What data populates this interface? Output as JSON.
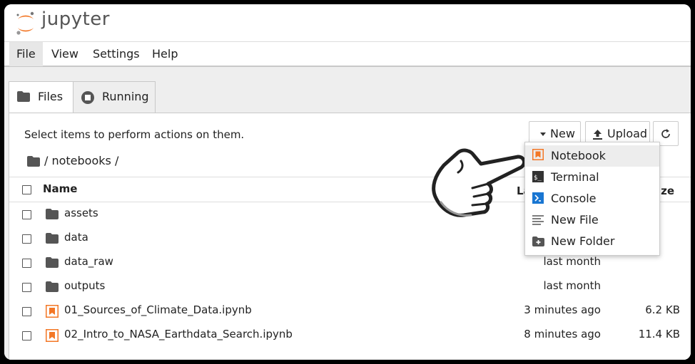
{
  "app": {
    "brand": "jupyter"
  },
  "menu": [
    "File",
    "View",
    "Settings",
    "Help"
  ],
  "tabs": {
    "files": "Files",
    "running": "Running"
  },
  "toolbar": {
    "hint": "Select items to perform actions on them.",
    "new_label": "New",
    "upload_label": "Upload"
  },
  "breadcrumb": {
    "path": "/ notebooks /"
  },
  "columns": {
    "name": "Name",
    "modified": "La",
    "size": "ize"
  },
  "files": [
    {
      "name": "assets",
      "type": "folder",
      "modified": "",
      "size": ""
    },
    {
      "name": "data",
      "type": "folder",
      "modified": "",
      "size": ""
    },
    {
      "name": "data_raw",
      "type": "folder",
      "modified": "last month",
      "size": ""
    },
    {
      "name": "outputs",
      "type": "folder",
      "modified": "last month",
      "size": ""
    },
    {
      "name": "01_Sources_of_Climate_Data.ipynb",
      "type": "notebook",
      "modified": "3 minutes ago",
      "size": "6.2 KB"
    },
    {
      "name": "02_Intro_to_NASA_Earthdata_Search.ipynb",
      "type": "notebook",
      "modified": "8 minutes ago",
      "size": "11.4 KB"
    }
  ],
  "new_menu": [
    "Notebook",
    "Terminal",
    "Console",
    "New File",
    "New Folder"
  ],
  "colors": {
    "accent": "#f37726",
    "folder": "#555555",
    "console": "#1976d2"
  }
}
